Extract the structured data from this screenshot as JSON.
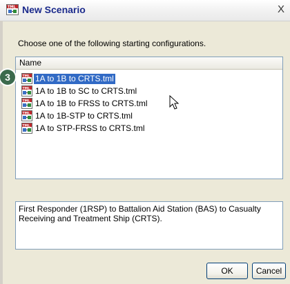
{
  "window": {
    "title": "New Scenario",
    "close_label": "X"
  },
  "instruction": "Choose one of the following starting configurations.",
  "list": {
    "column_header": "Name",
    "items": [
      {
        "label": "1A to 1B to CRTS.tml",
        "selected": true
      },
      {
        "label": "1A to 1B to SC to CRTS.tml",
        "selected": false
      },
      {
        "label": "1A to 1B to FRSS to CRTS.tml",
        "selected": false
      },
      {
        "label": "1A to 1B-STP to CRTS.tml",
        "selected": false
      },
      {
        "label": "1A to STP-FRSS to CRTS.tml",
        "selected": false
      }
    ]
  },
  "callout_badge": "3",
  "description": "First Responder (1RSP) to Battalion Aid Station (BAS) to Casualty Receiving and Treatment Ship (CRTS).",
  "buttons": {
    "ok": "OK",
    "cancel": "Cancel"
  },
  "icons": {
    "app": "tml-file-icon",
    "file": "tml-file-icon",
    "close": "close-icon",
    "cursor": "mouse-pointer-icon"
  },
  "colors": {
    "title_text": "#1b2a8c",
    "selection": "#316ac5",
    "badge": "#3c6a4d",
    "dialog_bg": "#ece9d8"
  }
}
